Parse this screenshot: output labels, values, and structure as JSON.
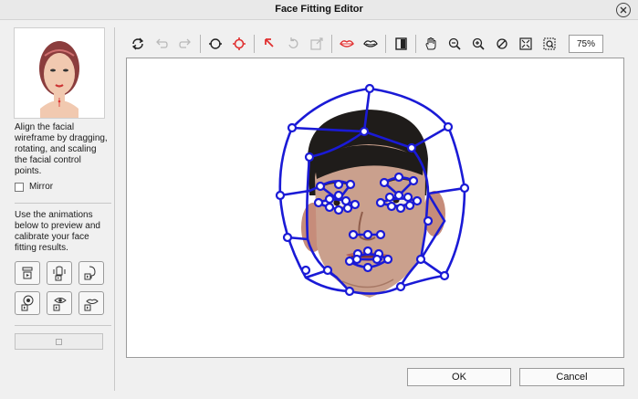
{
  "window": {
    "title": "Face Fitting Editor"
  },
  "left_panel": {
    "instruction": "Align the facial wireframe by dragging, rotating, and scaling the facial control points.",
    "mirror_label": "Mirror",
    "animation_instruction": "Use the animations below to preview and calibrate your face fitting results."
  },
  "toolbar": {
    "zoom_value": "75%"
  },
  "footer": {
    "ok_label": "OK",
    "cancel_label": "Cancel"
  },
  "colors": {
    "wireframe": "#1a1ad6",
    "wire_dot_fill": "#ffffff",
    "accent_red": "#e03030"
  }
}
